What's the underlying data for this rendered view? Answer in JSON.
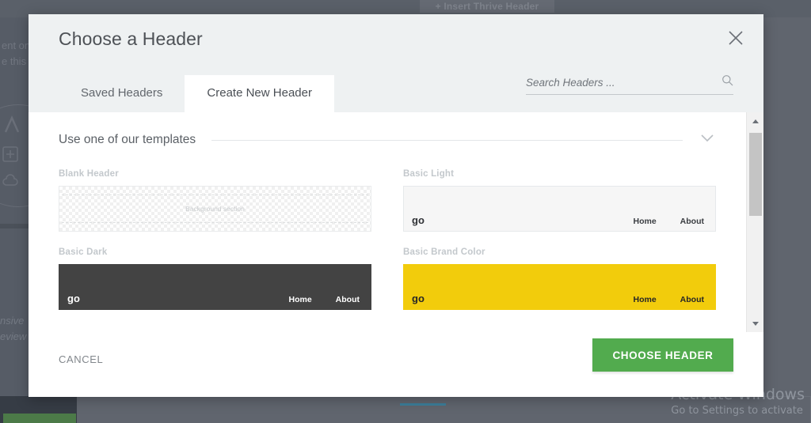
{
  "background": {
    "insert_button_label": "+ Insert Thrive Header",
    "text_fragment_1": "ent on",
    "text_fragment_2": "e this",
    "text_fragment_3": "nsive",
    "text_fragment_4": "eview"
  },
  "watermark": {
    "title": "Activate Windows",
    "subtitle": "Go to Settings to activate"
  },
  "modal": {
    "title": "Choose a Header",
    "close_icon": "close-icon",
    "tabs": [
      {
        "label": "Saved Headers",
        "active": false
      },
      {
        "label": "Create New Header",
        "active": true
      }
    ],
    "search": {
      "placeholder": "Search Headers ...",
      "value": "",
      "icon": "search-icon"
    },
    "section": {
      "title": "Use one of our templates",
      "collapse_icon": "chevron-down-icon"
    },
    "templates": [
      {
        "name": "Blank Header",
        "style": "blank",
        "placeholder_text": "Background section"
      },
      {
        "name": "Basic Light",
        "style": "light",
        "logo": "go",
        "links": [
          "Home",
          "About"
        ],
        "bg_color": "#f6f6f6"
      },
      {
        "name": "Basic Dark",
        "style": "dark",
        "logo": "go",
        "links": [
          "Home",
          "About"
        ],
        "bg_color": "#434343"
      },
      {
        "name": "Basic Brand Color",
        "style": "brand",
        "logo": "go",
        "links": [
          "Home",
          "About"
        ],
        "bg_color": "#f2cc0c"
      }
    ],
    "footer": {
      "cancel_label": "CANCEL",
      "confirm_label": "CHOOSE HEADER",
      "confirm_color": "#52ab4e"
    },
    "scrollbar": {
      "up_icon": "scroll-up-arrow-icon",
      "down_icon": "scroll-down-arrow-icon"
    }
  }
}
